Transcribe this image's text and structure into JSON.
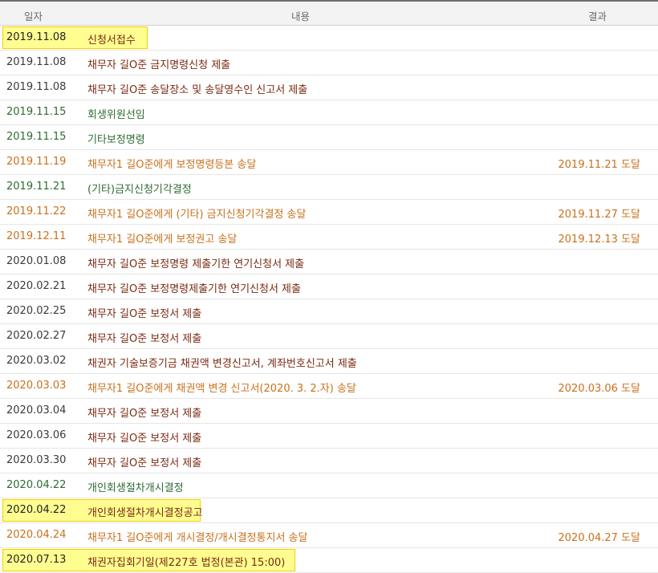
{
  "header": {
    "date": "일자",
    "content": "내용",
    "result": "결과"
  },
  "rows": [
    {
      "date": "2019.11.08",
      "content": "신청서접수",
      "result": "",
      "style": "hl"
    },
    {
      "date": "2019.11.08",
      "content": "채무자 길O준 금지명령신청 제출",
      "result": "",
      "style": "brown"
    },
    {
      "date": "2019.11.08",
      "content": "채무자 길O준 송달장소 및 송달영수인 신고서 제출",
      "result": "",
      "style": "brown"
    },
    {
      "date": "2019.11.15",
      "content": "회생위원선임",
      "result": "",
      "style": "green"
    },
    {
      "date": "2019.11.15",
      "content": "기타보정명령",
      "result": "",
      "style": "green"
    },
    {
      "date": "2019.11.19",
      "content": "채무자1 길O준에게 보정명령등본 송달",
      "result": "2019.11.21 도달",
      "style": "orange"
    },
    {
      "date": "2019.11.21",
      "content": "(기타)금지신청기각결정",
      "result": "",
      "style": "green"
    },
    {
      "date": "2019.11.22",
      "content": "채무자1 길O준에게 (기타) 금지신청기각결정 송달",
      "result": "2019.11.27 도달",
      "style": "orange"
    },
    {
      "date": "2019.12.11",
      "content": "채무자1 길O준에게 보정권고 송달",
      "result": "2019.12.13 도달",
      "style": "orange"
    },
    {
      "date": "2020.01.08",
      "content": "채무자 길O준 보정명령 제출기한 연기신청서 제출",
      "result": "",
      "style": "brown"
    },
    {
      "date": "2020.02.21",
      "content": "채무자 길O준 보정명령제출기한 연기신청서 제출",
      "result": "",
      "style": "brown"
    },
    {
      "date": "2020.02.25",
      "content": "채무자 길O준 보정서 제출",
      "result": "",
      "style": "brown"
    },
    {
      "date": "2020.02.27",
      "content": "채무자 길O준 보정서 제출",
      "result": "",
      "style": "brown"
    },
    {
      "date": "2020.03.02",
      "content": "채권자 기술보증기금 채권액 변경신고서, 계좌번호신고서 제출",
      "result": "",
      "style": "brown"
    },
    {
      "date": "2020.03.03",
      "content": "채무자1 길O준에게 채권액 변경 신고서(2020. 3. 2.자) 송달",
      "result": "2020.03.06 도달",
      "style": "orange"
    },
    {
      "date": "2020.03.04",
      "content": "채무자 길O준 보정서 제출",
      "result": "",
      "style": "brown"
    },
    {
      "date": "2020.03.06",
      "content": "채무자 길O준 보정서 제출",
      "result": "",
      "style": "brown"
    },
    {
      "date": "2020.03.30",
      "content": "채무자 길O준 보정서 제출",
      "result": "",
      "style": "brown"
    },
    {
      "date": "2020.04.22",
      "content": "개인회생절차개시결정",
      "result": "",
      "style": "green"
    },
    {
      "date": "2020.04.22",
      "content": "개인회생절차개시결정공고",
      "result": "",
      "style": "hl"
    },
    {
      "date": "2020.04.24",
      "content": "채무자1 길O준에게 개시결정/개시결정통지서 송달",
      "result": "2020.04.27 도달",
      "style": "orange"
    },
    {
      "date": "2020.07.13",
      "content": "채권자집회기일(제227호 법정(본관) 15:00)",
      "result": "",
      "style": "hl"
    }
  ]
}
